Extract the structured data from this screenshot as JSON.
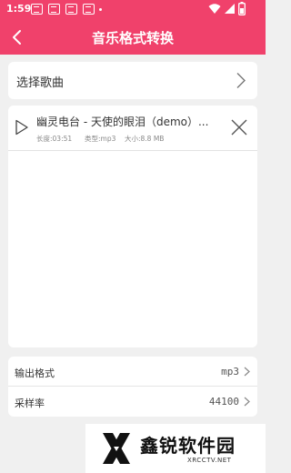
{
  "status_bar": {
    "time": "1:59",
    "icons": [
      "notification-icon",
      "notification-icon",
      "notification-icon",
      "dot-icon",
      "wifi-icon",
      "signal-icon",
      "battery-icon"
    ]
  },
  "header": {
    "title": "音乐格式转换",
    "back_icon": "back-arrow-icon"
  },
  "select_song": {
    "label": "选择歌曲",
    "icon": "chevron-right-icon"
  },
  "songs": [
    {
      "title": "幽灵电台 - 天使的眼泪（demo）...",
      "duration": "长度:03:51",
      "type": "类型:mp3",
      "size": "大小:8.8 MB"
    }
  ],
  "settings": {
    "format": {
      "label": "输出格式",
      "value": "mp3"
    },
    "sample_rate": {
      "label": "采样率",
      "value": "44100"
    }
  },
  "watermark": {
    "text": "鑫锐软件园",
    "sub": "XRCCTV.NET"
  },
  "colors": {
    "accent": "#f0416b",
    "background": "#f0f0f0"
  }
}
